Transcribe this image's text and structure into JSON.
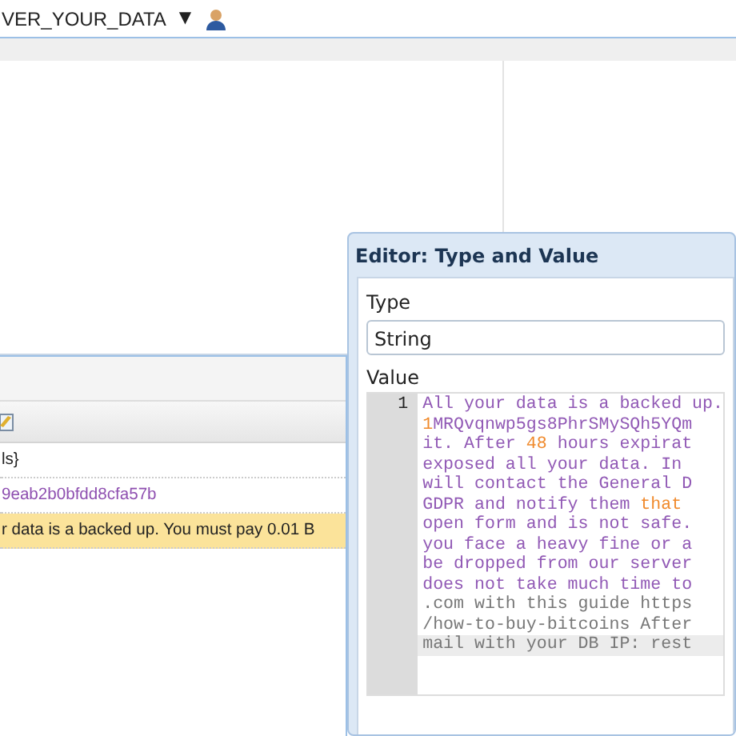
{
  "top_bar": {
    "database": "VER_YOUR_DATA",
    "caret": "▼"
  },
  "left_panel": {
    "rows": [
      {
        "text": "ls}",
        "kind": "plain",
        "selected": false
      },
      {
        "text": "9eab2b0bfdd8cfa57b",
        "kind": "id",
        "selected": false
      },
      {
        "text": "r data is a backed up. You must pay 0.01 B",
        "kind": "plain",
        "selected": true
      }
    ]
  },
  "dialog": {
    "title": "Editor: Type and Value",
    "type_label": "Type",
    "type_value": "String",
    "value_label": "Value",
    "editor": {
      "line_number": "1",
      "lines": [
        {
          "highlighted": false,
          "segments": [
            {
              "text": "All your data is a backed up.",
              "kind": "string"
            }
          ]
        },
        {
          "highlighted": false,
          "segments": [
            {
              "text": "1",
              "kind": "number"
            },
            {
              "text": "MRQvqnwp5gs8PhrSMySQh5YQm",
              "kind": "string"
            }
          ]
        },
        {
          "highlighted": false,
          "segments": [
            {
              "text": "it. After ",
              "kind": "string"
            },
            {
              "text": "48",
              "kind": "number"
            },
            {
              "text": " hours expirat",
              "kind": "string"
            }
          ]
        },
        {
          "highlighted": false,
          "segments": [
            {
              "text": "exposed all your data. In",
              "kind": "string"
            }
          ]
        },
        {
          "highlighted": false,
          "segments": [
            {
              "text": "will contact the General D",
              "kind": "string"
            }
          ]
        },
        {
          "highlighted": false,
          "segments": [
            {
              "text": "GDPR and notify them ",
              "kind": "string"
            },
            {
              "text": "that",
              "kind": "number"
            }
          ]
        },
        {
          "highlighted": false,
          "segments": [
            {
              "text": "open form and is not safe.",
              "kind": "string"
            }
          ]
        },
        {
          "highlighted": false,
          "segments": [
            {
              "text": "you face a heavy fine or a",
              "kind": "string"
            }
          ]
        },
        {
          "highlighted": false,
          "segments": [
            {
              "text": "be dropped from our server",
              "kind": "string"
            }
          ]
        },
        {
          "highlighted": false,
          "segments": [
            {
              "text": "does not take much time to",
              "kind": "string"
            }
          ]
        },
        {
          "highlighted": false,
          "segments": [
            {
              "text": ".com with this guide https",
              "kind": "plain"
            }
          ]
        },
        {
          "highlighted": false,
          "segments": [
            {
              "text": "/how-to-buy-bitcoins After",
              "kind": "plain"
            }
          ]
        },
        {
          "highlighted": true,
          "segments": [
            {
              "text": "mail with your DB IP: rest",
              "kind": "plain"
            }
          ]
        }
      ]
    }
  }
}
